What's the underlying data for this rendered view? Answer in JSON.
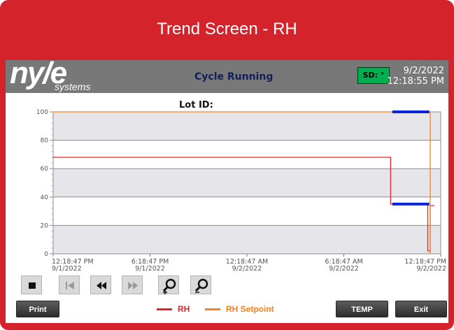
{
  "title": "Trend Screen - RH",
  "header": {
    "logo_main": "ny/e",
    "logo_sub": "systems",
    "cycle_status": "Cycle Running",
    "sd_label": "SD: °",
    "date": "9/2/2022",
    "time": "12:18:55 PM"
  },
  "lot_label": "Lot ID:",
  "chart_data": {
    "type": "line",
    "y_ticks": [
      "100",
      "80",
      "60",
      "40",
      "20",
      "0"
    ],
    "ylim": [
      0,
      100
    ],
    "x_ticks": [
      {
        "time": "12:18:47 PM",
        "date": "9/1/2022"
      },
      {
        "time": "6:18:47 PM",
        "date": "9/1/2022"
      },
      {
        "time": "12:18:47 AM",
        "date": "9/2/2022"
      },
      {
        "time": "6:18:47 AM",
        "date": "9/2/2022"
      },
      {
        "time": "12:18:47 PM",
        "date": "9/2/2022"
      }
    ],
    "x_tick_hours": [
      0,
      6,
      12,
      18,
      24
    ],
    "xlim_hours": [
      0,
      24
    ],
    "series": [
      {
        "name": "RH",
        "color": "#e8202a",
        "points": [
          [
            0,
            68
          ],
          [
            20.9,
            68
          ],
          [
            20.9,
            35
          ],
          [
            23.2,
            35
          ],
          [
            23.2,
            2
          ],
          [
            23.35,
            2
          ],
          [
            23.35,
            34
          ],
          [
            23.6,
            34
          ]
        ]
      },
      {
        "name": "RH Setpoint",
        "color": "#f58220",
        "points": [
          [
            0,
            100
          ],
          [
            23.35,
            100
          ],
          [
            23.35,
            0
          ]
        ]
      }
    ],
    "highlight_segments": [
      {
        "color": "#0b25d8",
        "points": [
          [
            21.0,
            100
          ],
          [
            23.3,
            100
          ]
        ]
      },
      {
        "color": "#0b25d8",
        "points": [
          [
            21.0,
            35
          ],
          [
            23.3,
            35
          ]
        ]
      }
    ],
    "grid": true
  },
  "controls": {
    "stop": "stop-icon",
    "first": "skip-back-icon",
    "rewind": "rewind-icon",
    "forward": "fast-forward-icon",
    "zoom_in": "zoom-in-icon",
    "zoom_out": "zoom-out-icon"
  },
  "buttons": {
    "print": "Print",
    "temp": "TEMP",
    "exit": "Exit"
  },
  "legend": {
    "rh": "RH",
    "rh_color": "#e8202a",
    "setpoint": "RH Setpoint",
    "setpoint_color": "#f58220"
  }
}
